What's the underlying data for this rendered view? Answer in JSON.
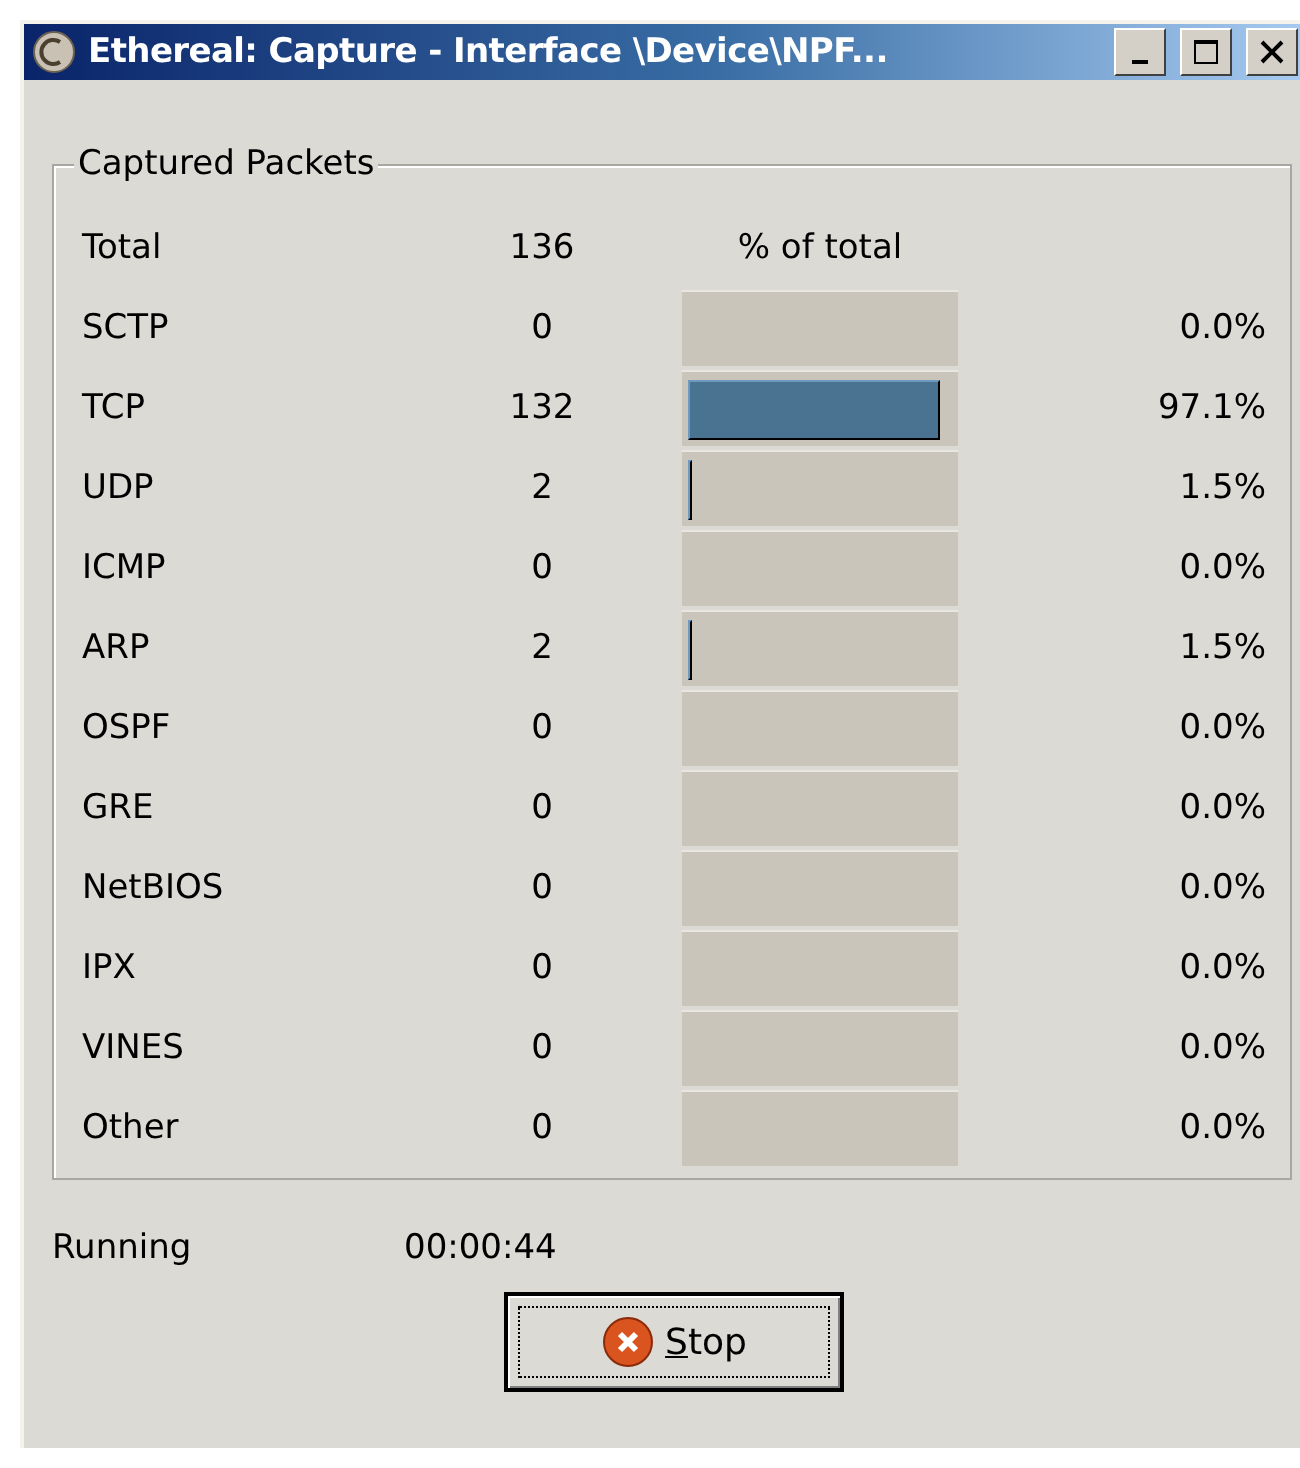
{
  "window": {
    "title": "Ethereal: Capture - Interface \\Device\\NPF..."
  },
  "captured_packets": {
    "title": "Captured Packets",
    "header": {
      "label": "Total",
      "count": "136",
      "percent_heading": "% of total"
    },
    "rows": [
      {
        "label": "SCTP",
        "count": "0",
        "level": 0,
        "percent": "0.0%"
      },
      {
        "label": "TCP",
        "count": "132",
        "level": 0.971,
        "percent": "97.1%"
      },
      {
        "label": "UDP",
        "count": "2",
        "level": 0.015,
        "percent": "1.5%"
      },
      {
        "label": "ICMP",
        "count": "0",
        "level": 0,
        "percent": "0.0%"
      },
      {
        "label": "ARP",
        "count": "2",
        "level": 0.015,
        "percent": "1.5%"
      },
      {
        "label": "OSPF",
        "count": "0",
        "level": 0,
        "percent": "0.0%"
      },
      {
        "label": "GRE",
        "count": "0",
        "level": 0,
        "percent": "0.0%"
      },
      {
        "label": "NetBIOS",
        "count": "0",
        "level": 0,
        "percent": "0.0%"
      },
      {
        "label": "IPX",
        "count": "0",
        "level": 0,
        "percent": "0.0%"
      },
      {
        "label": "VINES",
        "count": "0",
        "level": 0,
        "percent": "0.0%"
      },
      {
        "label": "Other",
        "count": "0",
        "level": 0,
        "percent": "0.0%"
      }
    ]
  },
  "status": {
    "label": "Running",
    "time": "00:00:44"
  },
  "stop_button": {
    "label": "Stop"
  }
}
